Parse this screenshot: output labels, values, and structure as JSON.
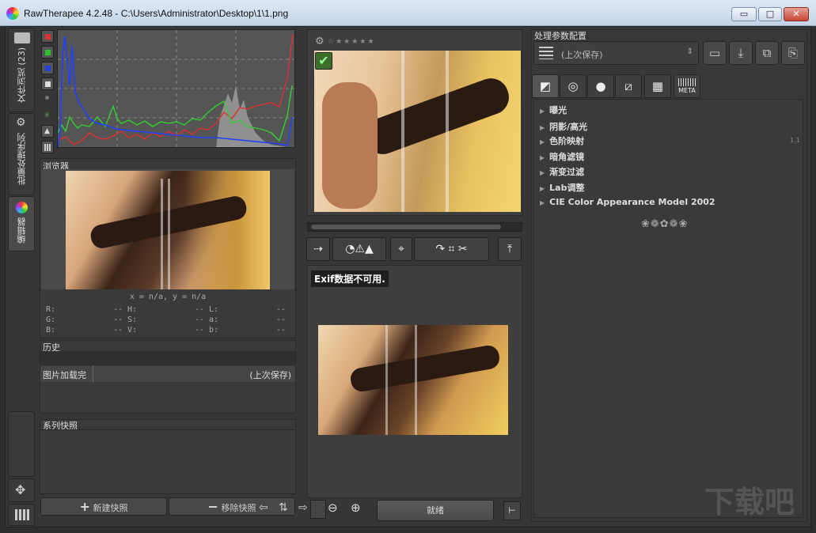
{
  "window": {
    "title": "RawTherapee 4.2.48 - C:\\Users\\Administrator\\Desktop\\1\\1.png",
    "min": "▭",
    "max": "□",
    "close": "✕"
  },
  "tabs": {
    "file_browser": "文件浏览 (23)",
    "batch_queue": "批量处理序列",
    "editor": "编辑器"
  },
  "navigator": {
    "title": "浏览器",
    "coords": "x = n/a, y = n/a",
    "rows": [
      [
        "R:",
        "--",
        "H:",
        "--",
        "L:",
        "--"
      ],
      [
        "G:",
        "--",
        "S:",
        "--",
        "a:",
        "--"
      ],
      [
        "B:",
        "--",
        "V:",
        "--",
        "b:",
        "--"
      ]
    ]
  },
  "history": {
    "title": "历史",
    "item_label": "图片加载完",
    "item_value": "(上次保存)"
  },
  "snapshots": {
    "title": "系列快照",
    "add": "新建快照",
    "remove": "移除快照"
  },
  "preview": {
    "exif_msg": "Exif数据不可用.",
    "status": "就绪",
    "stars": "☆★★★★★"
  },
  "profile": {
    "title": "处理参数配置",
    "selected": "(上次保存)"
  },
  "tool_tabs": [
    "exposure-tab",
    "detail-tab",
    "color-tab",
    "transform-tab",
    "raw-tab",
    "metadata-tab"
  ],
  "meta_tab_label": "META",
  "tools": [
    "曝光",
    "阴影/高光",
    "色阶映射",
    "暗角滤镜",
    "渐变过滤",
    "Lab调整",
    "CIE Color Appearance Model 2002"
  ],
  "tool_badge": "1.1",
  "watermark": "下载吧",
  "colors": {
    "bg": "#363636",
    "panel": "#3a3a3a",
    "hist_red": "#e03030",
    "hist_green": "#30d030",
    "hist_blue": "#2040ff"
  }
}
